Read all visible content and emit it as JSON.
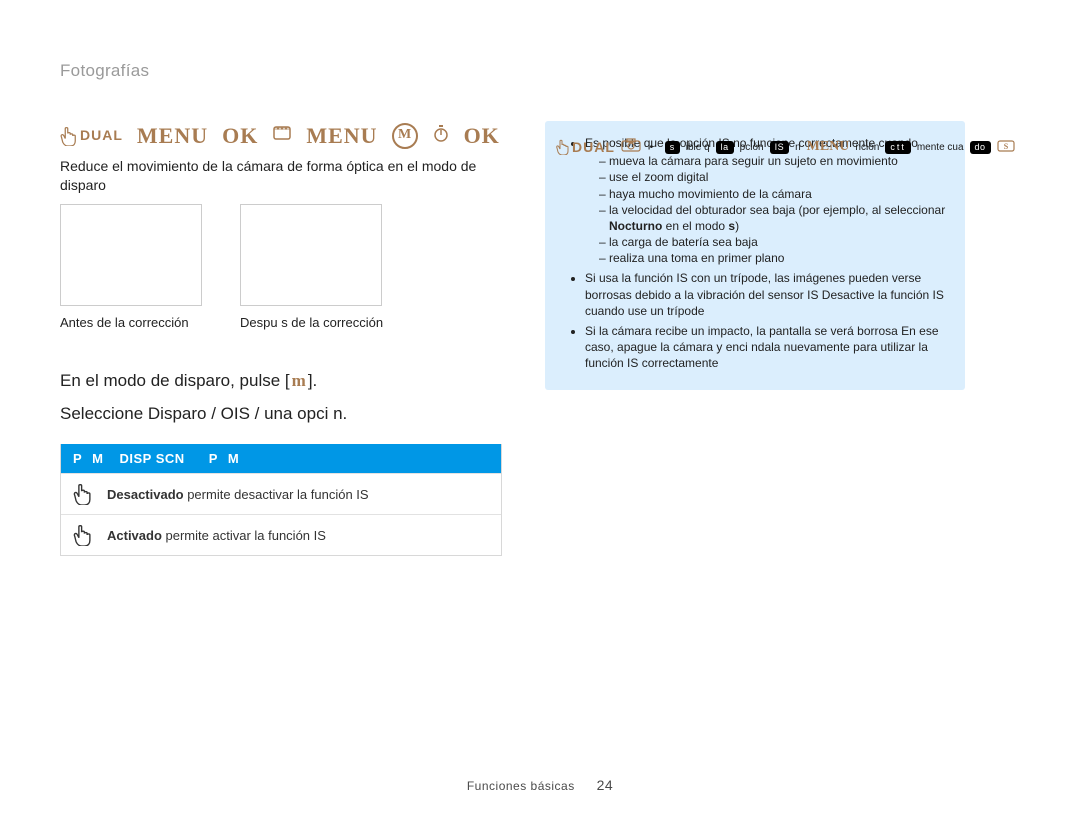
{
  "breadcrumb": "Fotografías",
  "dualLabel": "DUAL",
  "menuLabel": "MENU",
  "okLabel": "OK",
  "mLabel": "M",
  "intro": "Reduce el movimiento de la cámara de forma óptica en el modo de disparo",
  "beforeCaption": "Antes de la corrección",
  "afterCaption": "Despu s de la corrección",
  "step1_a": "En el modo de disparo, pulse [",
  "step1_iconLabel": "m",
  "step1_b": "].",
  "step2": "Seleccione Disparo  /  OIS  / una opci n.",
  "optionsHeader": {
    "col1a": "P",
    "col1b": "M",
    "col2": "DISP  SCN",
    "col3a": "P",
    "col3b": "M"
  },
  "options": [
    {
      "name": "Desactivado",
      "desc": " permite desactivar la función  IS"
    },
    {
      "name": "Activado",
      "desc": " permite activar la función  IS"
    }
  ],
  "topStrip": {
    "pre": "s",
    "p1": "ible q",
    "p2": "la",
    "p3": "pción",
    "p4": "IS",
    "p5": "n",
    "p6": "ncion",
    "p7": "ctt",
    "p8": "mente cua",
    "p9": "do"
  },
  "notes": {
    "bullet1": "Es posible que la opción  IS no funcione correctamente cuando",
    "sub1": "mueva la cámara para seguir un sujeto en movimiento",
    "sub2": "use el zoom digital",
    "sub3": "haya mucho movimiento de la cámara",
    "sub4a": "la velocidad del obturador sea baja (por ejemplo, al seleccionar",
    "sub4b": "Nocturno",
    "sub4c": " en el modo ",
    "sub4d": "s",
    "sub4e": ")",
    "sub5": "la carga de batería sea baja",
    "sub6": "realiza una toma en primer plano",
    "bullet2": "Si usa la función  IS con un trípode, las imágenes pueden verse borrosas debido a la vibración del sensor  IS  Desactive la función IS cuando use un trípode",
    "bullet3": "Si la cámara recibe un impacto, la pantalla se verá borrosa  En ese caso, apague la cámara y enci ndala nuevamente para utilizar la función  IS correctamente"
  },
  "footerSection": "Funciones básicas",
  "pageNumber": "24"
}
